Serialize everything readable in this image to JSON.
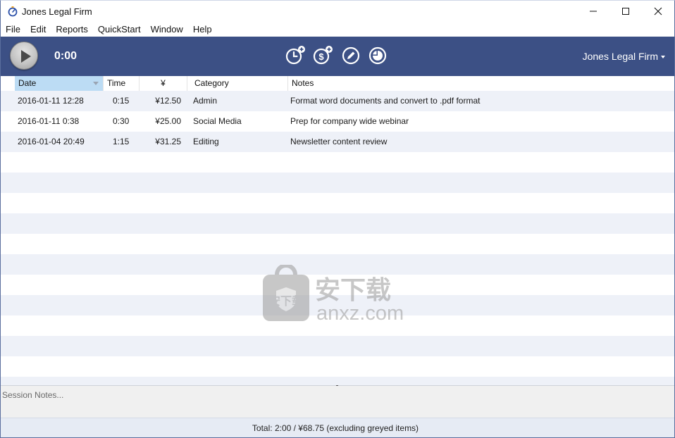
{
  "window": {
    "title": "Jones Legal Firm"
  },
  "menu": {
    "items": [
      "File",
      "Edit",
      "Reports",
      "QuickStart",
      "Window",
      "Help"
    ]
  },
  "toolbar": {
    "timer": "0:00",
    "client": "Jones Legal Firm",
    "icons": [
      "play-icon",
      "add-time-icon",
      "add-expense-icon",
      "edit-icon",
      "pie-chart-icon"
    ]
  },
  "table": {
    "headers": {
      "date": "Date",
      "time": "Time",
      "amount": "¥",
      "category": "Category",
      "notes": "Notes"
    },
    "rows": [
      {
        "date": "2016-01-11  12:28",
        "time": "0:15",
        "amount": "¥12.50",
        "category": "Admin",
        "notes": "Format word documents and convert to .pdf format"
      },
      {
        "date": "2016-01-11  0:38",
        "time": "0:30",
        "amount": "¥25.00",
        "category": "Social Media",
        "notes": "Prep for company wide webinar"
      },
      {
        "date": "2016-01-04  20:49",
        "time": "1:15",
        "amount": "¥31.25",
        "category": "Editing",
        "notes": "Newsletter content review"
      }
    ]
  },
  "watermark": {
    "text_cn": "安下载",
    "text_en": "anxz.com"
  },
  "session_notes": {
    "placeholder": "Session Notes..."
  },
  "status": {
    "total": "Total: 2:00 / ¥68.75 (excluding greyed items)"
  },
  "colors": {
    "toolbar": "#3c5085",
    "row_alt": "#eef1f8",
    "sort_header": "#bcdcf4",
    "status_bar": "#e6ebf4"
  }
}
